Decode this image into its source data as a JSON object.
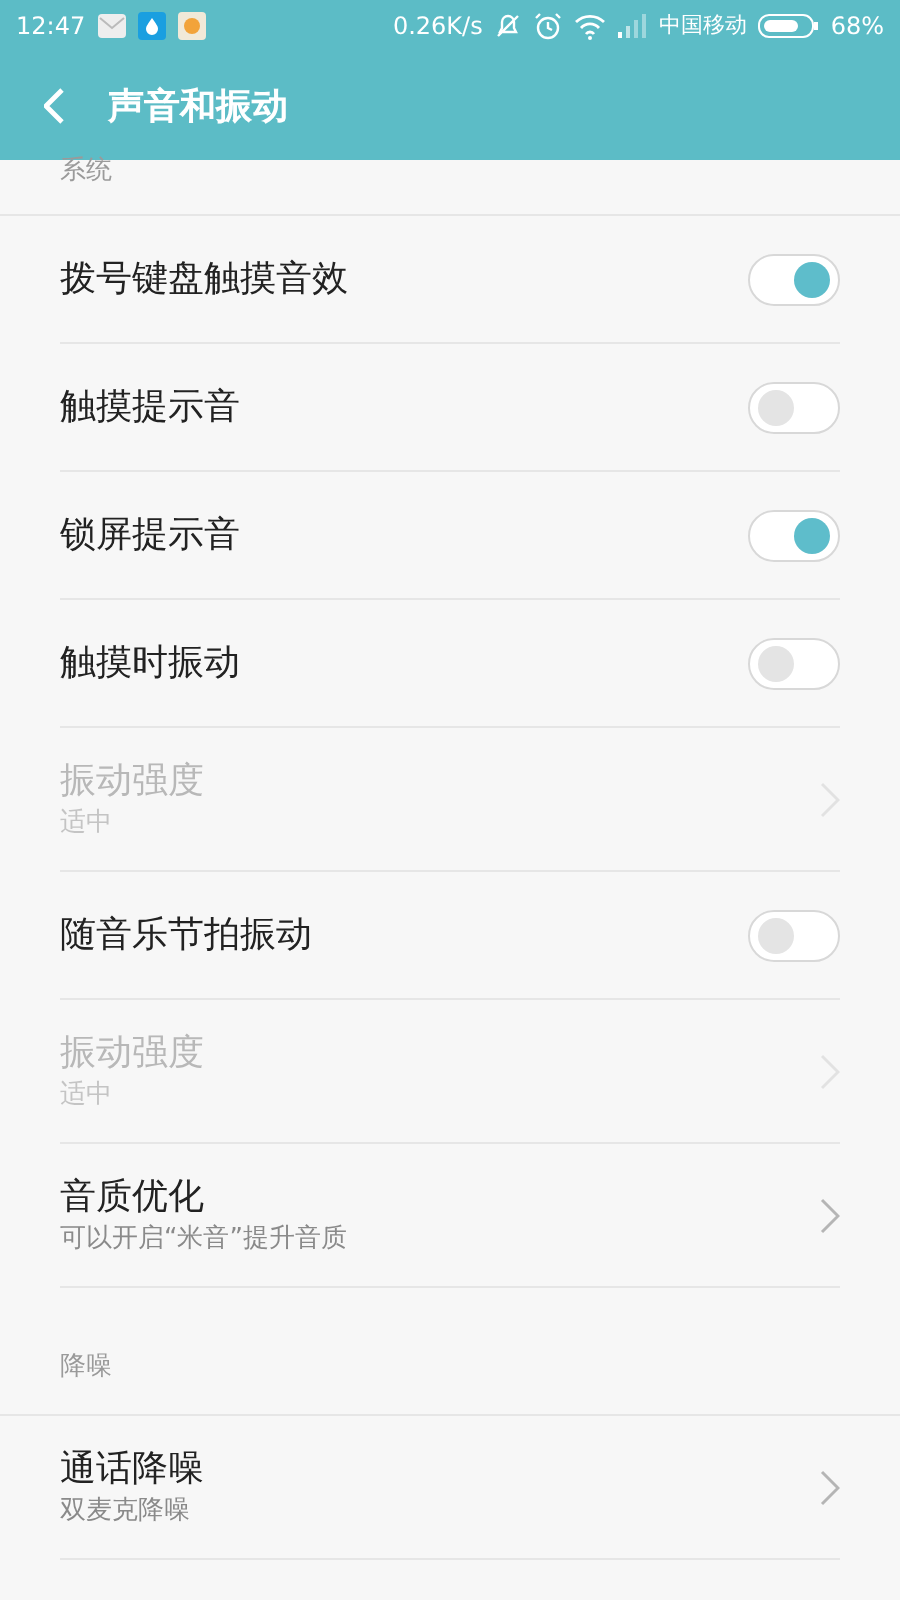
{
  "status_bar": {
    "time": "12:47",
    "speed": "0.26K/s",
    "carrier": "中国移动",
    "battery": "68%"
  },
  "header": {
    "title": "声音和振动"
  },
  "items": [
    {
      "kind": "section",
      "label": "系统"
    },
    {
      "kind": "toggle",
      "label": "拨号键盘触摸音效",
      "on": true
    },
    {
      "kind": "toggle",
      "label": "触摸提示音",
      "on": false
    },
    {
      "kind": "toggle",
      "label": "锁屏提示音",
      "on": true
    },
    {
      "kind": "toggle",
      "label": "触摸时振动",
      "on": false
    },
    {
      "kind": "nav",
      "label": "振动强度",
      "subtitle": "适中",
      "disabled": true
    },
    {
      "kind": "toggle",
      "label": "随音乐节拍振动",
      "on": false
    },
    {
      "kind": "nav",
      "label": "振动强度",
      "subtitle": "适中",
      "disabled": true
    },
    {
      "kind": "nav",
      "label": "音质优化",
      "subtitle": "可以开启“米音”提升音质",
      "disabled": false
    },
    {
      "kind": "section",
      "label": "降噪"
    },
    {
      "kind": "nav",
      "label": "通话降噪",
      "subtitle": "双麦克降噪",
      "disabled": false
    }
  ]
}
